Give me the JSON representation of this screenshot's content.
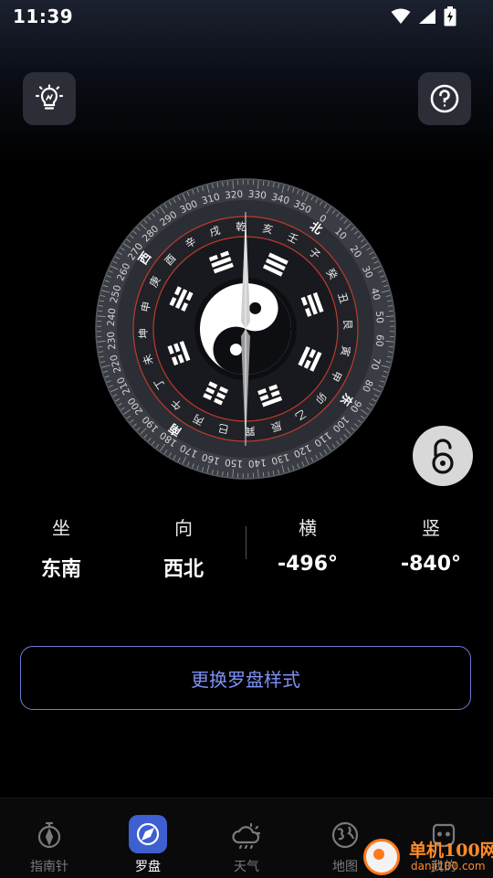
{
  "status": {
    "time": "11:39"
  },
  "compass": {
    "degree_labels": [
      "0",
      "10",
      "20",
      "30",
      "40",
      "50",
      "60",
      "70",
      "80",
      "90",
      "100",
      "110",
      "120",
      "130",
      "140",
      "150",
      "160",
      "170",
      "180",
      "190",
      "200",
      "210",
      "220",
      "230",
      "240",
      "250",
      "260",
      "270",
      "280",
      "290",
      "300",
      "310",
      "320",
      "330",
      "340",
      "350"
    ],
    "mountains": [
      "子",
      "癸",
      "丑",
      "艮",
      "寅",
      "甲",
      "卯",
      "乙",
      "辰",
      "巽",
      "巳",
      "丙",
      "午",
      "丁",
      "未",
      "坤",
      "申",
      "庚",
      "酉",
      "辛",
      "戌",
      "乾",
      "亥",
      "壬"
    ],
    "directions": [
      "北",
      "东",
      "南",
      "西"
    ]
  },
  "readouts": {
    "sit": {
      "label": "坐",
      "value": "东南"
    },
    "face": {
      "label": "向",
      "value": "西北"
    },
    "horizontal": {
      "label": "横",
      "value": "-496°"
    },
    "vertical": {
      "label": "竖",
      "value": "-840°"
    }
  },
  "change_style_label": "更换罗盘样式",
  "nav": {
    "compass": "指南针",
    "luopan": "罗盘",
    "weather": "天气",
    "map": "地图",
    "mine": "我的"
  },
  "watermark": {
    "title": "单机100网",
    "url": "danji100.com"
  },
  "colors": {
    "accent": "#7e92f5",
    "nav_active": "#3d5fd0",
    "ring_red": "#c0392b"
  }
}
